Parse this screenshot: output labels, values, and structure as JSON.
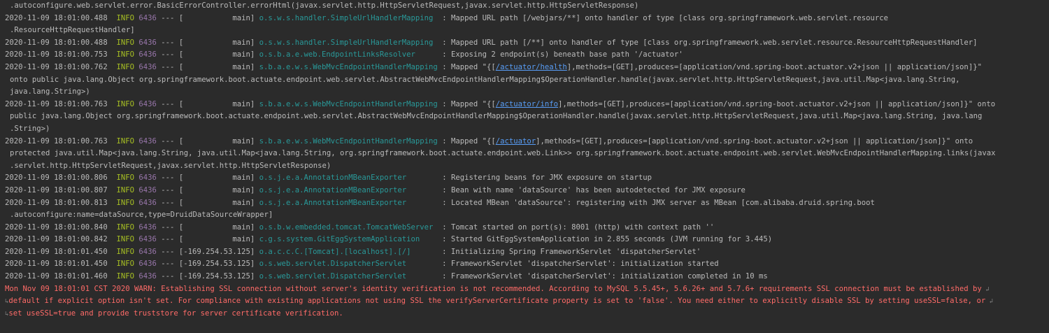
{
  "lines": [
    {
      "kind": "cont",
      "text": ".autoconfigure.web.servlet.error.BasicErrorController.errorHtml(javax.servlet.http.HttpServletRequest,javax.servlet.http.HttpServletResponse)"
    },
    {
      "kind": "log",
      "ts": "2020-11-09 18:01:00.488",
      "level": "INFO",
      "pid": "6436",
      "sep": "---",
      "thread_prefix": "[",
      "thread_dots": "         ",
      "thread": "main]",
      "logger": "o.s.w.s.handler.SimpleUrlHandlerMapping",
      "pad": "  ",
      "msg": ": Mapped URL path [/webjars/**] onto handler of type [class org.springframework.web.servlet.resource"
    },
    {
      "kind": "cont",
      "text": ".ResourceHttpRequestHandler]"
    },
    {
      "kind": "log",
      "ts": "2020-11-09 18:01:00.488",
      "level": "INFO",
      "pid": "6436",
      "sep": "---",
      "thread_prefix": "[",
      "thread_dots": "         ",
      "thread": "main]",
      "logger": "o.s.w.s.handler.SimpleUrlHandlerMapping",
      "pad": "  ",
      "msg": ": Mapped URL path [/**] onto handler of type [class org.springframework.web.servlet.resource.ResourceHttpRequestHandler]"
    },
    {
      "kind": "log",
      "ts": "2020-11-09 18:01:00.753",
      "level": "INFO",
      "pid": "6436",
      "sep": "---",
      "thread_prefix": "[",
      "thread_dots": "         ",
      "thread": "main]",
      "logger": "o.s.b.a.e.web.EndpointLinksResolver",
      "pad": "      ",
      "msg": ": Exposing 2 endpoint(s) beneath base path '/actuator'"
    },
    {
      "kind": "log_link",
      "ts": "2020-11-09 18:01:00.762",
      "level": "INFO",
      "pid": "6436",
      "sep": "---",
      "thread_prefix": "[",
      "thread_dots": "         ",
      "thread": "main]",
      "logger": "s.b.a.e.w.s.WebMvcEndpointHandlerMapping",
      "pad": " ",
      "msg_before": ": Mapped \"{[",
      "link": "/actuator/health",
      "msg_after": "],methods=[GET],produces=[application/vnd.spring-boot.actuator.v2+json || application/json]}\""
    },
    {
      "kind": "cont",
      "text": "onto public java.lang.Object org.springframework.boot.actuate.endpoint.web.servlet.AbstractWebMvcEndpointHandlerMapping$OperationHandler.handle(javax.servlet.http.HttpServletRequest,java.util.Map<java.lang.String,"
    },
    {
      "kind": "cont",
      "text": "java.lang.String>)"
    },
    {
      "kind": "log_link",
      "ts": "2020-11-09 18:01:00.763",
      "level": "INFO",
      "pid": "6436",
      "sep": "---",
      "thread_prefix": "[",
      "thread_dots": "         ",
      "thread": "main]",
      "logger": "s.b.a.e.w.s.WebMvcEndpointHandlerMapping",
      "pad": " ",
      "msg_before": ": Mapped \"{[",
      "link": "/actuator/info",
      "msg_after": "],methods=[GET],produces=[application/vnd.spring-boot.actuator.v2+json || application/json]}\" onto"
    },
    {
      "kind": "cont",
      "text": "public java.lang.Object org.springframework.boot.actuate.endpoint.web.servlet.AbstractWebMvcEndpointHandlerMapping$OperationHandler.handle(javax.servlet.http.HttpServletRequest,java.util.Map<java.lang.String, java.lang"
    },
    {
      "kind": "cont",
      "text": ".String>)"
    },
    {
      "kind": "log_link",
      "ts": "2020-11-09 18:01:00.763",
      "level": "INFO",
      "pid": "6436",
      "sep": "---",
      "thread_prefix": "[",
      "thread_dots": "         ",
      "thread": "main]",
      "logger": "s.b.a.e.w.s.WebMvcEndpointHandlerMapping",
      "pad": " ",
      "msg_before": ": Mapped \"{[",
      "link": "/actuator",
      "msg_after": "],methods=[GET],produces=[application/vnd.spring-boot.actuator.v2+json || application/json]}\" onto"
    },
    {
      "kind": "cont",
      "text": "protected java.util.Map<java.lang.String, java.util.Map<java.lang.String, org.springframework.boot.actuate.endpoint.web.Link>> org.springframework.boot.actuate.endpoint.web.servlet.WebMvcEndpointHandlerMapping.links(javax"
    },
    {
      "kind": "cont",
      "text": ".servlet.http.HttpServletRequest,javax.servlet.http.HttpServletResponse)"
    },
    {
      "kind": "log",
      "ts": "2020-11-09 18:01:00.806",
      "level": "INFO",
      "pid": "6436",
      "sep": "---",
      "thread_prefix": "[",
      "thread_dots": "         ",
      "thread": "main]",
      "logger": "o.s.j.e.a.AnnotationMBeanExporter",
      "pad": "        ",
      "msg": ": Registering beans for JMX exposure on startup"
    },
    {
      "kind": "log",
      "ts": "2020-11-09 18:01:00.807",
      "level": "INFO",
      "pid": "6436",
      "sep": "---",
      "thread_prefix": "[",
      "thread_dots": "         ",
      "thread": "main]",
      "logger": "o.s.j.e.a.AnnotationMBeanExporter",
      "pad": "        ",
      "msg": ": Bean with name 'dataSource' has been autodetected for JMX exposure"
    },
    {
      "kind": "log",
      "ts": "2020-11-09 18:01:00.813",
      "level": "INFO",
      "pid": "6436",
      "sep": "---",
      "thread_prefix": "[",
      "thread_dots": "         ",
      "thread": "main]",
      "logger": "o.s.j.e.a.AnnotationMBeanExporter",
      "pad": "        ",
      "msg": ": Located MBean 'dataSource': registering with JMX server as MBean [com.alibaba.druid.spring.boot"
    },
    {
      "kind": "cont",
      "text": ".autoconfigure:name=dataSource,type=DruidDataSourceWrapper]"
    },
    {
      "kind": "log",
      "ts": "2020-11-09 18:01:00.840",
      "level": "INFO",
      "pid": "6436",
      "sep": "---",
      "thread_prefix": "[",
      "thread_dots": "         ",
      "thread": "main]",
      "logger": "o.s.b.w.embedded.tomcat.TomcatWebServer",
      "pad": "  ",
      "msg": ": Tomcat started on port(s): 8001 (http) with context path ''"
    },
    {
      "kind": "log",
      "ts": "2020-11-09 18:01:00.842",
      "level": "INFO",
      "pid": "6436",
      "sep": "---",
      "thread_prefix": "[",
      "thread_dots": "         ",
      "thread": "main]",
      "logger": "c.g.s.system.GitEggSystemApplication",
      "pad": "     ",
      "msg": ": Started GitEggSystemApplication in 2.855 seconds (JVM running for 3.445)"
    },
    {
      "kind": "log",
      "ts": "2020-11-09 18:01:01.450",
      "level": "INFO",
      "pid": "6436",
      "sep": "---",
      "thread_prefix": "",
      "thread_dots": "",
      "thread": "[-169.254.53.125]",
      "logger": "o.a.c.c.C.[Tomcat].[localhost].[/]",
      "pad": "       ",
      "msg": ": Initializing Spring FrameworkServlet 'dispatcherServlet'"
    },
    {
      "kind": "log",
      "ts": "2020-11-09 18:01:01.450",
      "level": "INFO",
      "pid": "6436",
      "sep": "---",
      "thread_prefix": "",
      "thread_dots": "",
      "thread": "[-169.254.53.125]",
      "logger": "o.s.web.servlet.DispatcherServlet",
      "pad": "        ",
      "msg": ": FrameworkServlet 'dispatcherServlet': initialization started"
    },
    {
      "kind": "log",
      "ts": "2020-11-09 18:01:01.460",
      "level": "INFO",
      "pid": "6436",
      "sep": "---",
      "thread_prefix": "",
      "thread_dots": "",
      "thread": "[-169.254.53.125]",
      "logger": "o.s.web.servlet.DispatcherServlet",
      "pad": "        ",
      "msg": ": FrameworkServlet 'dispatcherServlet': initialization completed in 10 ms"
    },
    {
      "kind": "err",
      "text": "Mon Nov 09 18:01:01 CST 2020 WARN: Establishing SSL connection without server's identity verification is not recommended. According to MySQL 5.5.45+, 5.6.26+ and 5.7.6+ requirements SSL connection must be established by",
      "wrap": true
    },
    {
      "kind": "err_cont",
      "text": "default if explicit option isn't set. For compliance with existing applications not using SSL the verifyServerCertificate property is set to 'false'. You need either to explicitly disable SSL by setting useSSL=false, or",
      "wrap": true
    },
    {
      "kind": "err_cont",
      "text": "set useSSL=true and provide truststore for server certificate verification.",
      "wrap": false
    }
  ],
  "colors": {
    "background": "#2b2b2b",
    "text": "#bbbbbb",
    "info_level": "#a8c023",
    "pid": "#9876aa",
    "logger": "#299999",
    "link": "#589df6",
    "error": "#ff6b68"
  },
  "icons": {
    "soft_wrap_mark": "soft-wrap-icon"
  }
}
